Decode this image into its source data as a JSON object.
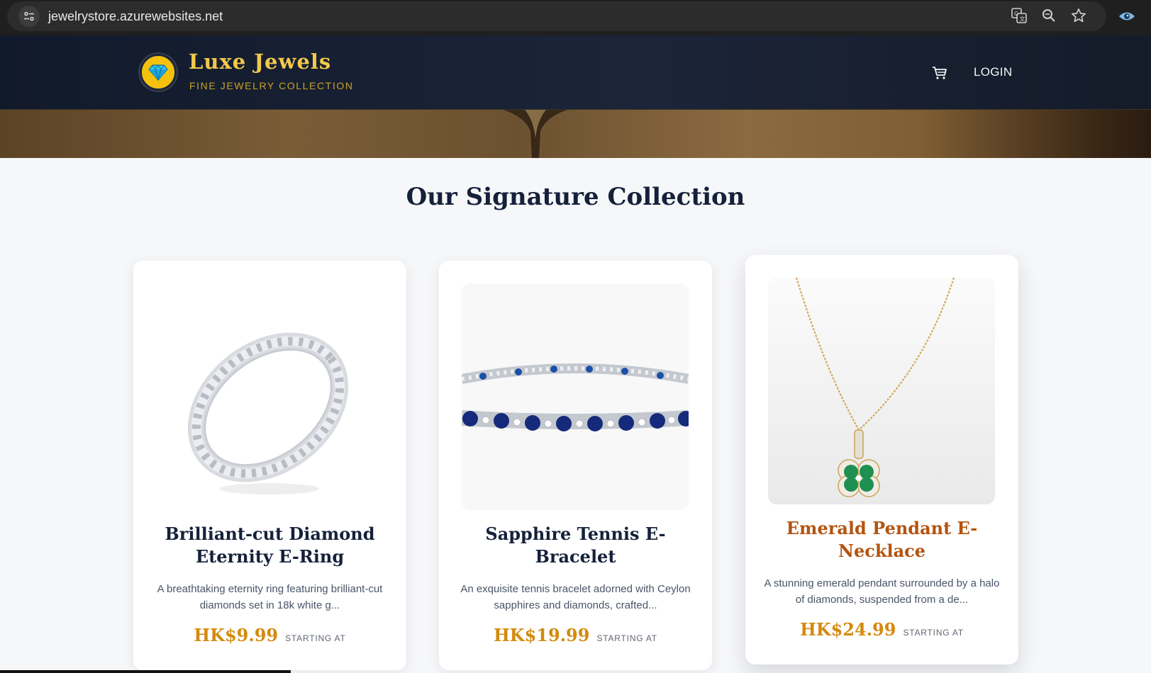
{
  "browser": {
    "url": "jewelrystore.azurewebsites.net"
  },
  "header": {
    "brand_name": "Luxe Jewels",
    "brand_tagline": "FINE JEWELRY COLLECTION",
    "login_label": "LOGIN"
  },
  "main": {
    "section_title": "Our Signature Collection",
    "products": [
      {
        "title": "Brilliant-cut Diamond Eternity E-Ring",
        "description": "A breathtaking eternity ring featuring brilliant-cut diamonds set in 18k white g...",
        "price": "HK$9.99",
        "price_note": "STARTING AT"
      },
      {
        "title": "Sapphire Tennis E-Bracelet",
        "description": "An exquisite tennis bracelet adorned with Ceylon sapphires and diamonds, crafted...",
        "price": "HK$19.99",
        "price_note": "STARTING AT"
      },
      {
        "title": "Emerald Pendant E-Necklace",
        "description": "A stunning emerald pendant surrounded by a halo of diamonds, suspended from a de...",
        "price": "HK$24.99",
        "price_note": "STARTING AT"
      }
    ]
  },
  "colors": {
    "header_bg": "#1c2538",
    "brand_gold": "#f2c94c",
    "price_gold": "#d48a0e",
    "title_navy": "#15213a",
    "hover_title": "#b4530f"
  }
}
